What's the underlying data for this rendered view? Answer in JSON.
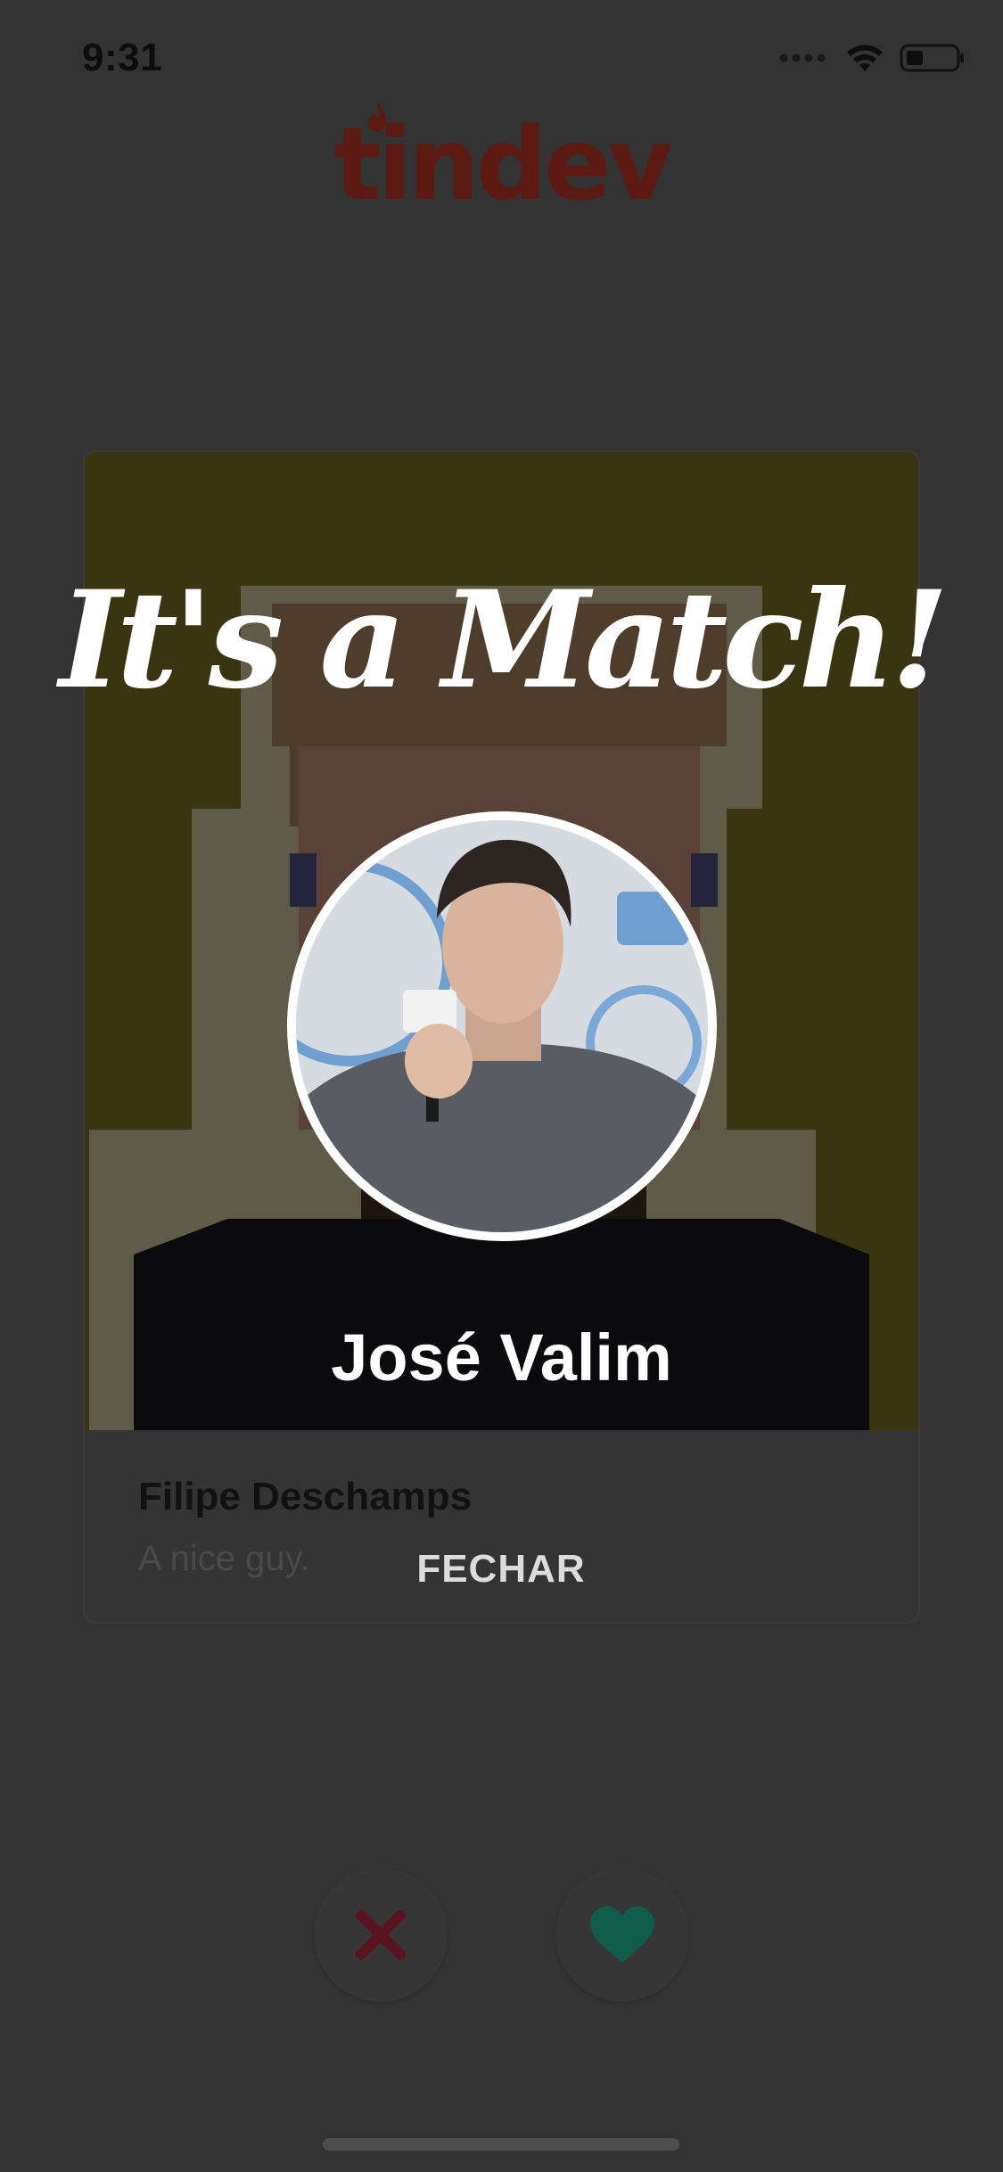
{
  "status_bar": {
    "time": "9:31"
  },
  "app": {
    "logo_text": "tindev",
    "brand_color": "#5c1a12"
  },
  "card": {
    "name": "Filipe Deschamps",
    "bio": "A nice guy."
  },
  "match": {
    "title": "It's a Match!",
    "name": "José Valim",
    "close_label": "FECHAR"
  },
  "actions": {
    "dislike_icon": "close-icon",
    "like_icon": "heart-icon",
    "dislike_color": "#5a1420",
    "like_color": "#0f5d4a"
  }
}
